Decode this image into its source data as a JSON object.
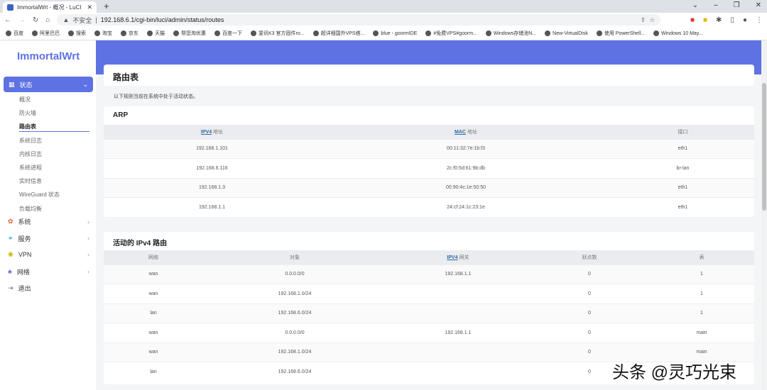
{
  "browser": {
    "tab_title": "ImmortalWrt - 概况 - LuCI",
    "new_tab": "+",
    "insecure": "不安全",
    "url": "192.168.6.1/cgi-bin/luci/admin/status/routes",
    "bookmarks": [
      "百度",
      "阿里巴巴",
      "搜索",
      "淘宝",
      "京东",
      "天猫",
      "帮您淘优惠",
      "百度一下",
      "斐讯K3 官方固件ro...",
      "超详细国外VPS搭...",
      "blue - goormIDE",
      "#免费VPS#goorm...",
      "Windows存储池N...",
      "New-VirtualDisk",
      "使用 PowerShell...",
      "Windows 10 May..."
    ]
  },
  "sidebar": {
    "logo": "ImmortalWrt",
    "active": "状态",
    "sub_items": [
      "概况",
      "防火墙",
      "路由表",
      "系统日志",
      "内核日志",
      "系统进程",
      "实时信息",
      "WireGuard 状态",
      "负载均衡"
    ],
    "items": [
      "系统",
      "服务",
      "VPN",
      "网络",
      "退出"
    ]
  },
  "page": {
    "title": "路由表",
    "description": "以下规则当前在系统中处于活动状态。"
  },
  "arp": {
    "title": "ARP",
    "headers": [
      {
        "abbr": "IPV4",
        "rest": " 地址"
      },
      {
        "abbr": "MAC",
        "rest": " 地址"
      },
      {
        "abbr": "",
        "rest": "接口"
      }
    ],
    "rows": [
      [
        "192.168.1.101",
        "00:11:32:7e:1b:f3",
        "eth1"
      ],
      [
        "192.168.6.116",
        "2c:f0:5d:61:9b:db",
        "br-lan"
      ],
      [
        "192.168.1.3",
        "00:90:4c:1e:50:50",
        "eth1"
      ],
      [
        "192.168.1.1",
        "24:cf:24:1c:23:1e",
        "eth1"
      ]
    ]
  },
  "routes": {
    "title": "活动的 IPv4 路由",
    "headers": [
      "网络",
      "对象",
      "IPV4",
      "网关",
      "跃点数",
      "表"
    ],
    "rows": [
      [
        "wan",
        "0.0.0.0/0",
        "192.168.1.1",
        "0",
        "1"
      ],
      [
        "wan",
        "192.168.1.0/24",
        "",
        "0",
        "1"
      ],
      [
        "lan",
        "192.168.6.0/24",
        "",
        "0",
        "1"
      ],
      [
        "wan",
        "0.0.0.0/0",
        "192.168.1.1",
        "0",
        "main"
      ],
      [
        "wan",
        "192.168.1.0/24",
        "",
        "0",
        "main"
      ],
      [
        "lan",
        "192.168.6.0/24",
        "",
        "0",
        ""
      ]
    ]
  },
  "watermark": "头条 @灵巧光束"
}
